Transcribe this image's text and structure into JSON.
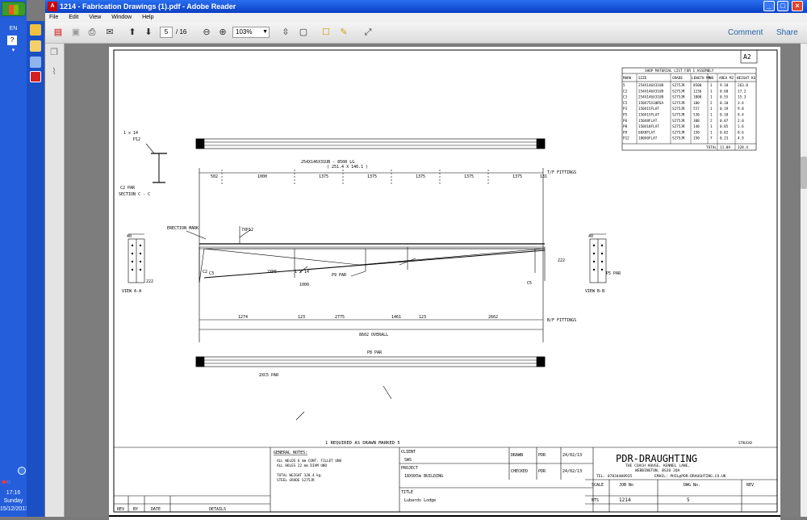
{
  "taskbar": {
    "lang": "EN",
    "clock_time": "17:16",
    "clock_day": "Sunday",
    "clock_date": "15/12/2013"
  },
  "window": {
    "title": "1214 - Fabrication Drawings (1).pdf - Adobe Reader",
    "menu": [
      "File",
      "Edit",
      "View",
      "Window",
      "Help"
    ],
    "page_current": "5",
    "page_total": "/ 16",
    "zoom": "103%",
    "comment": "Comment",
    "share": "Share"
  },
  "drawing": {
    "sheet_size": "A2",
    "material_list": {
      "title": "SHOP MATERIAL LIST FOR 1 ASSEMBLY",
      "headers": [
        "MARK",
        "SIZE",
        "GRADE",
        "LENGTH MM",
        "NO",
        "AREA M2",
        "WEIGHT KG"
      ],
      "rows": [
        [
          "5",
          "254X146X31UB",
          "S275JR",
          "8508",
          "1",
          "9.10",
          "263.8"
        ],
        [
          "C2",
          "254X146X31UB",
          "S275JR",
          "1236",
          "1",
          "0.60",
          "17.2"
        ],
        [
          "C3",
          "254X146X31UB",
          "S275JR",
          "1008",
          "1",
          "0.55",
          "15.3"
        ],
        [
          "C5",
          "150X75X10RSA",
          "S275JR",
          "100",
          "2",
          "0.10",
          "3.4"
        ],
        [
          "P3",
          "150X15FLAT",
          "S275JR",
          "557",
          "1",
          "0.19",
          "9.8"
        ],
        [
          "P5",
          "150X15FLAT",
          "S275JR",
          "530",
          "1",
          "0.18",
          "9.4"
        ],
        [
          "P6",
          "150X8FLAT",
          "S275JR",
          "308",
          "2",
          "0.07",
          "2.0"
        ],
        [
          "P8",
          "150X10FLAT",
          "S275JR",
          "140",
          "1",
          "0.05",
          "1.6"
        ],
        [
          "P9",
          "60X8FLAT",
          "S275JR",
          "150",
          "1",
          "0.02",
          "0.6"
        ],
        [
          "P12",
          "100X6FLAT",
          "S275JR",
          "150",
          "7",
          "0.23",
          "4.9"
        ]
      ],
      "total_label": "TOTAL",
      "total_area": "11.09",
      "total_weight": "328.4"
    },
    "labels": {
      "member": "254X146X31UB - 8508 LG",
      "cut": "( 251.4 X 146.1 )",
      "tf_fittings": "T/F FITTINGS",
      "bf_fittings": "B/F FITTINGS",
      "overall": "8602 OVERALL",
      "section_cc": "SECTION C - C",
      "c2_par": "C2 PAR",
      "view_aa": "VIEW A-A",
      "view_bb": "VIEW B-B",
      "erection_mark": "ERECTION MARK",
      "x14": "1 x 14",
      "p12": "P12",
      "p5_par": "P5 PAR",
      "p9_par": "P9 PAR",
      "p8_par": "P8 PAR",
      "x7p12": "7XP12",
      "x2p6": "2XP6",
      "x2c5_par": "2XC5 PAR",
      "c3": "C3",
      "c2": "C2",
      "c5": "C5",
      "required": "1 REQUIRED AS DRAWN MARKED 5",
      "strucad": "STRUCAD",
      "top_dims": [
        "502",
        "1000",
        "1375",
        "1375",
        "1375",
        "1375",
        "1375",
        "131"
      ],
      "bottom_dims": [
        "1274",
        "123",
        "2775",
        "1461",
        "123",
        "2662"
      ],
      "dim_40": "40",
      "dim_222": "222",
      "dim_1000": "1000",
      "dim_1x14b": "1 x 14"
    },
    "title_block": {
      "general_notes_title": "GENERAL NOTES:",
      "notes": [
        "ALL WELDS 6 mm CONT. FILLET UNO",
        "ALL HOLES 22 mm DIAM UNO",
        "",
        "TOTAL WEIGHT 328.4 kg.",
        "STEEL GRADE S275JR"
      ],
      "client_label": "CLIENT",
      "client": "SWS",
      "project_label": "PROJECT",
      "project": "18X9X5m BUILDING",
      "title_label": "TITLE",
      "title": "Lubards Lodge",
      "drawn_label": "DRAWN",
      "drawn_by": "PDR",
      "drawn_date": "24/02/13",
      "checked_label": "CHECKED",
      "checked_by": "PDR",
      "checked_date": "24/02/13",
      "company": "PDR-DRAUGHTING",
      "address1": "THE COACH HOUSE, KENNEL LANE,",
      "address2": "WEBBINGTON, BS26 2QA",
      "tel": "TEL: 07834408935",
      "email": "EMAIL: PHIL@PDR-DRAUGHTING.CO.UK",
      "scale_label": "SCALE",
      "job_label": "JOB No",
      "dwg_label": "DWG No.",
      "rev_label": "REV",
      "scale": "NTS",
      "job_no": "1214",
      "dwg_no": "5",
      "rev_by_headers": [
        "REV",
        "BY",
        "DATE",
        "DETAILS"
      ]
    }
  }
}
